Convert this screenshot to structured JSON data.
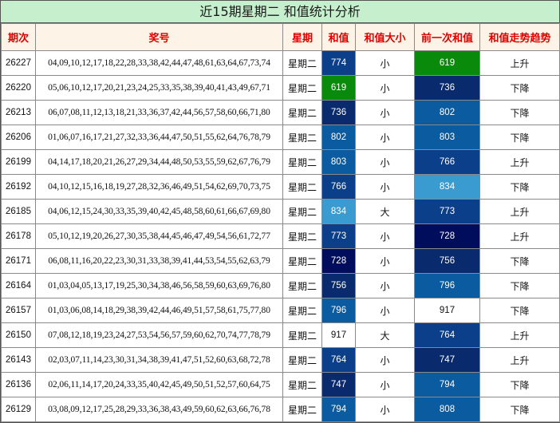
{
  "title": "近15期星期二 和值统计分析",
  "headers": [
    "期次",
    "奖号",
    "星期",
    "和值",
    "和值大小",
    "前一次和值",
    "和值走势趋势"
  ],
  "rows": [
    {
      "period": "26227",
      "numbers": "04,09,10,12,17,18,22,28,33,38,42,44,47,48,61,63,64,67,73,74",
      "week": "星期二",
      "sum": "774",
      "sum_color": "#0b3f8a",
      "size": "小",
      "prev_sum": "619",
      "prev_color": "#0a8a0a",
      "trend": "上升"
    },
    {
      "period": "26220",
      "numbers": "05,06,10,12,17,20,21,23,24,25,33,35,38,39,40,41,43,49,67,71",
      "week": "星期二",
      "sum": "619",
      "sum_color": "#0a8a0a",
      "size": "小",
      "prev_sum": "736",
      "prev_color": "#0a2a6e",
      "trend": "下降"
    },
    {
      "period": "26213",
      "numbers": "06,07,08,11,12,13,18,21,33,36,37,42,44,56,57,58,60,66,71,80",
      "week": "星期二",
      "sum": "736",
      "sum_color": "#0a2a6e",
      "size": "小",
      "prev_sum": "802",
      "prev_color": "#0a5ba0",
      "trend": "下降"
    },
    {
      "period": "26206",
      "numbers": "01,06,07,16,17,21,27,32,33,36,44,47,50,51,55,62,64,76,78,79",
      "week": "星期二",
      "sum": "802",
      "sum_color": "#0a5ba0",
      "size": "小",
      "prev_sum": "803",
      "prev_color": "#0a5ba0",
      "trend": "下降"
    },
    {
      "period": "26199",
      "numbers": "04,14,17,18,20,21,26,27,29,34,44,48,50,53,55,59,62,67,76,79",
      "week": "星期二",
      "sum": "803",
      "sum_color": "#0a5ba0",
      "size": "小",
      "prev_sum": "766",
      "prev_color": "#0b3f8a",
      "trend": "上升"
    },
    {
      "period": "26192",
      "numbers": "04,10,12,15,16,18,19,27,28,32,36,46,49,51,54,62,69,70,73,75",
      "week": "星期二",
      "sum": "766",
      "sum_color": "#0b3f8a",
      "size": "小",
      "prev_sum": "834",
      "prev_color": "#3a9bd0",
      "trend": "下降"
    },
    {
      "period": "26185",
      "numbers": "04,06,12,15,24,30,33,35,39,40,42,45,48,58,60,61,66,67,69,80",
      "week": "星期二",
      "sum": "834",
      "sum_color": "#3a9bd0",
      "size": "大",
      "prev_sum": "773",
      "prev_color": "#0b3f8a",
      "trend": "上升"
    },
    {
      "period": "26178",
      "numbers": "05,10,12,19,20,26,27,30,35,38,44,45,46,47,49,54,56,61,72,77",
      "week": "星期二",
      "sum": "773",
      "sum_color": "#0b3f8a",
      "size": "小",
      "prev_sum": "728",
      "prev_color": "#000c5c",
      "trend": "上升"
    },
    {
      "period": "26171",
      "numbers": "06,08,11,16,20,22,23,30,31,33,38,39,41,44,53,54,55,62,63,79",
      "week": "星期二",
      "sum": "728",
      "sum_color": "#000c5c",
      "size": "小",
      "prev_sum": "756",
      "prev_color": "#0a2a6e",
      "trend": "下降"
    },
    {
      "period": "26164",
      "numbers": "01,03,04,05,13,17,19,25,30,34,38,46,56,58,59,60,63,69,76,80",
      "week": "星期二",
      "sum": "756",
      "sum_color": "#0a2a6e",
      "size": "小",
      "prev_sum": "796",
      "prev_color": "#0a5ba0",
      "trend": "下降"
    },
    {
      "period": "26157",
      "numbers": "01,03,06,08,14,18,29,38,39,42,44,46,49,51,57,58,61,75,77,80",
      "week": "星期二",
      "sum": "796",
      "sum_color": "#0a5ba0",
      "size": "小",
      "prev_sum": "917",
      "prev_color": "#ffffff",
      "trend": "下降"
    },
    {
      "period": "26150",
      "numbers": "07,08,12,18,19,23,24,27,53,54,56,57,59,60,62,70,74,77,78,79",
      "week": "星期二",
      "sum": "917",
      "sum_color": "#ffffff",
      "size": "大",
      "prev_sum": "764",
      "prev_color": "#0b3f8a",
      "trend": "上升"
    },
    {
      "period": "26143",
      "numbers": "02,03,07,11,14,23,30,31,34,38,39,41,47,51,52,60,63,68,72,78",
      "week": "星期二",
      "sum": "764",
      "sum_color": "#0b3f8a",
      "size": "小",
      "prev_sum": "747",
      "prev_color": "#0a2a6e",
      "trend": "上升"
    },
    {
      "period": "26136",
      "numbers": "02,06,11,14,17,20,24,33,35,40,42,45,49,50,51,52,57,60,64,75",
      "week": "星期二",
      "sum": "747",
      "sum_color": "#0a2a6e",
      "size": "小",
      "prev_sum": "794",
      "prev_color": "#0a5ba0",
      "trend": "下降"
    },
    {
      "period": "26129",
      "numbers": "03,08,09,12,17,25,28,29,33,36,38,43,49,59,60,62,63,66,76,78",
      "week": "星期二",
      "sum": "794",
      "sum_color": "#0a5ba0",
      "size": "小",
      "prev_sum": "808",
      "prev_color": "#0a5ba0",
      "trend": "下降"
    }
  ]
}
